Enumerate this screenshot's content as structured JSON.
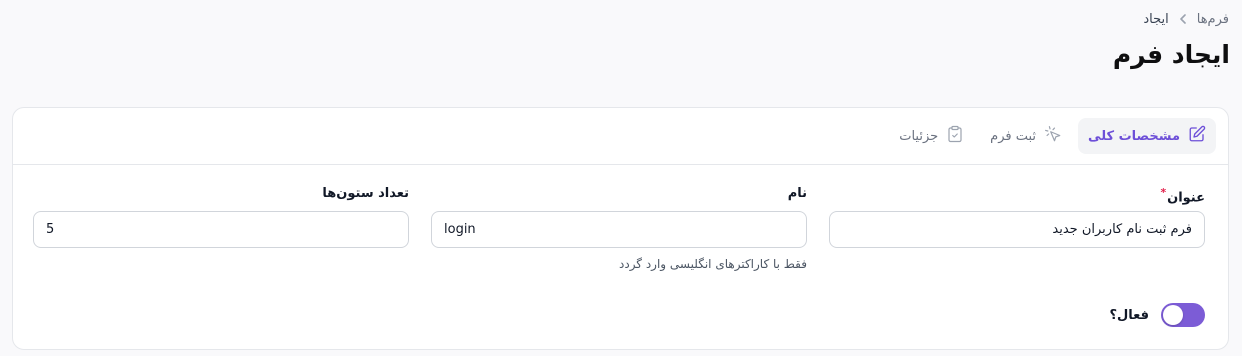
{
  "breadcrumb": {
    "parent": "فرم‌ها",
    "current": "ایجاد"
  },
  "page_title": "ایجاد فرم",
  "tabs": [
    {
      "label": "مشخصات کلی",
      "icon": "edit-icon",
      "active": true
    },
    {
      "label": "ثبت فرم",
      "icon": "cursor-click-icon",
      "active": false
    },
    {
      "label": "جزئیات",
      "icon": "clipboard-check-icon",
      "active": false
    }
  ],
  "fields": {
    "title": {
      "label": "عنوان",
      "required_mark": "*",
      "value": "فرم ثبت نام کاربران جدید"
    },
    "name": {
      "label": "نام",
      "value": "login",
      "hint": "فقط با کاراکترهای انگلیسی وارد گردد"
    },
    "columns": {
      "label": "تعداد ستون‌ها",
      "value": "5"
    }
  },
  "active_toggle": {
    "label": "فعال؟",
    "checked": true
  },
  "colors": {
    "accent": "#7c5cd6",
    "tab_active_text": "#6d4fd8",
    "required": "#e11d48"
  }
}
